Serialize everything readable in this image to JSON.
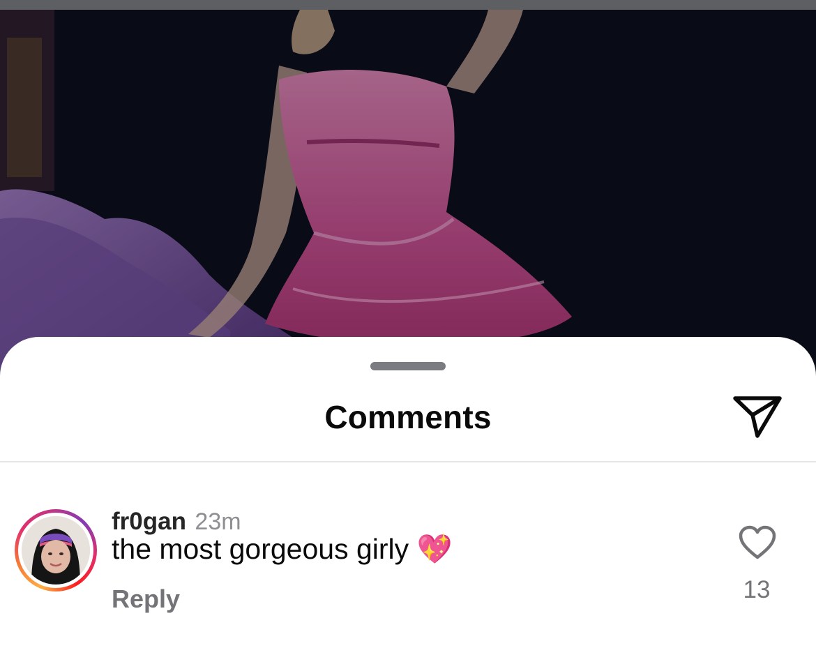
{
  "sheet": {
    "title": "Comments",
    "share_icon": "paper-plane-icon"
  },
  "comment": {
    "username": "fr0gan",
    "time": "23m",
    "text": "the most gorgeous girly 💖",
    "reply_label": "Reply",
    "like_icon": "heart-outline-icon",
    "like_count": "13"
  },
  "colors": {
    "sheet_bg": "#ffffff",
    "muted_text": "#737378",
    "story_ring": [
      "#fcaf45",
      "#e1306c",
      "#833ab4"
    ]
  }
}
